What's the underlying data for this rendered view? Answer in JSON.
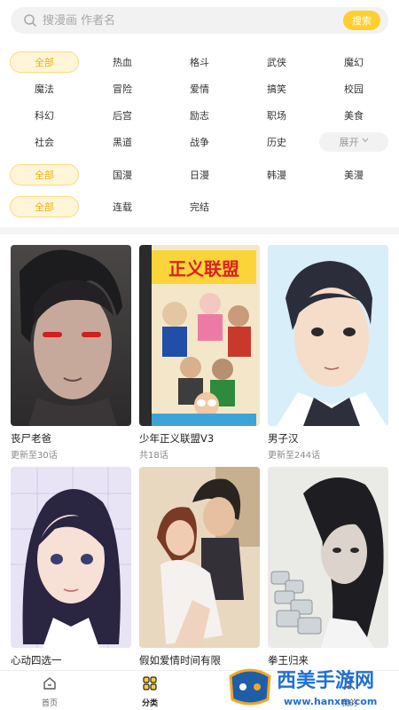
{
  "search": {
    "placeholder": "搜漫画 作者名",
    "button_label": "搜索"
  },
  "filters": {
    "genre": {
      "items": [
        "全部",
        "热血",
        "格斗",
        "武侠",
        "魔幻",
        "魔法",
        "冒险",
        "爱情",
        "搞笑",
        "校园",
        "科幻",
        "后宫",
        "励志",
        "职场",
        "美食",
        "社会",
        "黑道",
        "战争",
        "历史"
      ],
      "selected": "全部",
      "expand_label": "展开"
    },
    "region": {
      "items": [
        "全部",
        "国漫",
        "日漫",
        "韩漫",
        "美漫"
      ],
      "selected": "全部"
    },
    "status": {
      "items": [
        "全部",
        "连载",
        "完结"
      ],
      "selected": "全部"
    }
  },
  "comics": [
    {
      "title": "丧尸老爸",
      "subtitle": "更新至30话"
    },
    {
      "title": "少年正义联盟V3",
      "subtitle": "共18话",
      "cover_text": "正义联盟"
    },
    {
      "title": "男子汉",
      "subtitle": "更新至244话"
    },
    {
      "title": "心动四选一",
      "subtitle": ""
    },
    {
      "title": "假如爱情时间有限",
      "subtitle": ""
    },
    {
      "title": "拳王归来",
      "subtitle": ""
    }
  ],
  "nav": {
    "home_label": "首页",
    "category_label": "分类",
    "mine_label": "我的"
  },
  "watermark": {
    "brand": "西美手游网",
    "url": "www.hanxm.com"
  },
  "colors": {
    "accent": "#ffcf2e",
    "chip_active_bg": "#fff6da",
    "chip_active_text": "#f0b000"
  }
}
